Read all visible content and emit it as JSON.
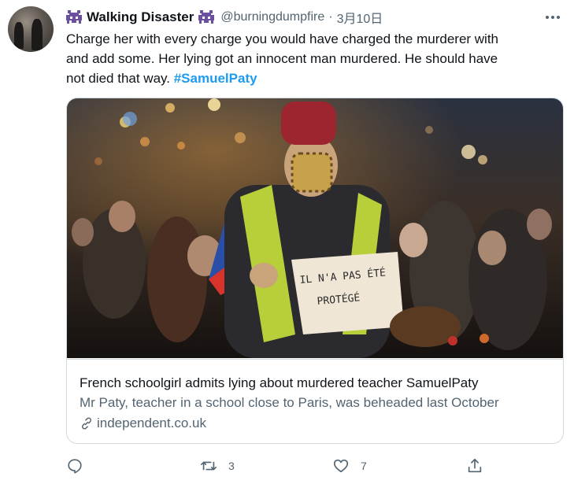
{
  "tweet": {
    "author_name": "Walking Disaster",
    "author_handle": "@burningdumpfire",
    "separator": "·",
    "date": "3月10日",
    "text_line1": "Charge her with every charge you would have charged the murderer with",
    "text_line2": "and add some. Her lying got an innocent man murdered. He should have",
    "text_line3": "not died that way. ",
    "hashtag": "#SamuelPaty"
  },
  "card": {
    "sign_text_line1": "IL N'A PAS ÉTÉ",
    "sign_text_line2": "PROTÉGÉ",
    "title": "French schoolgirl admits lying about murdered teacher SamuelPaty",
    "description": "Mr Paty, teacher in a school close to Paris, was beheaded last October",
    "domain": "independent.co.uk"
  },
  "actions": {
    "retweet_count": "3",
    "like_count": "7"
  },
  "colors": {
    "accent": "#1d9bf0",
    "secondary_text": "#536471",
    "alien_purple": "#6b4fa0"
  },
  "icons": [
    "avatar",
    "alien-emoji-icon",
    "more-icon",
    "link-icon",
    "reply-icon",
    "retweet-icon",
    "like-icon",
    "share-icon"
  ]
}
